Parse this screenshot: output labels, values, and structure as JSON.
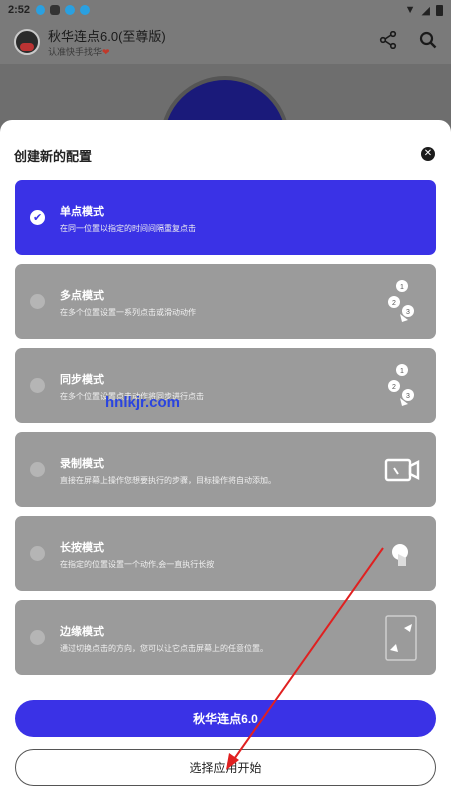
{
  "status_bar": {
    "time": "2:52"
  },
  "app_bar": {
    "title": "秋华连点6.0(至尊版)",
    "subtitle": "认准快手找华"
  },
  "dialog": {
    "title": "创建新的配置",
    "modes": [
      {
        "title": "单点模式",
        "desc": "在同一位置以指定的时间间隔重复点击",
        "selected": true,
        "icon": "none"
      },
      {
        "title": "多点模式",
        "desc": "在多个位置设置一系列点击或滑动动作",
        "selected": false,
        "icon": "multi-tap-icon"
      },
      {
        "title": "同步模式",
        "desc": "在多个位置设置点击动作将同步进行点击",
        "selected": false,
        "icon": "sync-tap-icon"
      },
      {
        "title": "录制模式",
        "desc": "直接在屏幕上操作您想要执行的步骤，目标操作将自动添加。",
        "selected": false,
        "icon": "record-icon"
      },
      {
        "title": "长按模式",
        "desc": "在指定的位置设置一个动作,会一直执行长按",
        "selected": false,
        "icon": "long-press-icon"
      },
      {
        "title": "边缘模式",
        "desc": "通过切换点击的方向，您可以让它点击屏幕上的任意位置。",
        "selected": false,
        "icon": "edge-icon"
      }
    ],
    "primary_button": "秋华连点6.0",
    "secondary_button": "选择应用开始"
  },
  "watermark": "hnlkjr.com",
  "colors": {
    "accent": "#3a32e6",
    "card": "#9b9b9b",
    "overlay": "#6e6e6e",
    "annotation_arrow": "#e02020"
  }
}
